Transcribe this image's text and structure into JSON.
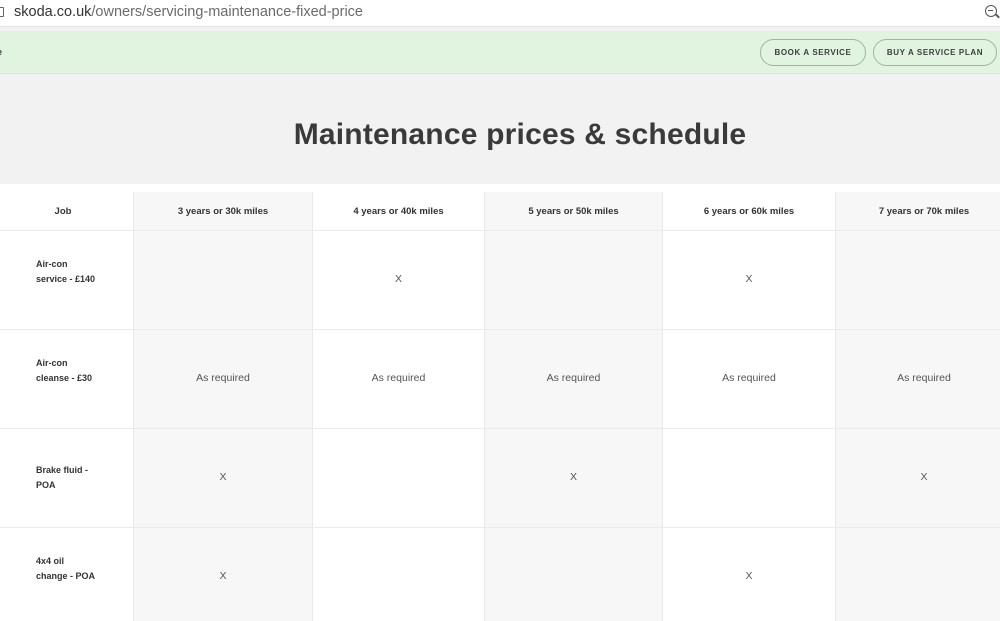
{
  "browser": {
    "url_host": "skoda.co.uk",
    "url_path": "/owners/servicing-maintenance-fixed-price"
  },
  "band": {
    "left_fragment": "e",
    "book_label": "BOOK A SERVICE",
    "plan_label": "BUY A SERVICE PLAN"
  },
  "page": {
    "title": "Maintenance prices & schedule"
  },
  "table": {
    "headers": [
      "Job",
      "3 years or 30k miles",
      "4 years or 40k miles",
      "5 years or 50k miles",
      "6 years or 60k miles",
      "7 years or 70k miles"
    ],
    "rows": [
      {
        "job": "Air-con service - £140",
        "cells": [
          "",
          "X",
          "",
          "X",
          ""
        ]
      },
      {
        "job": "Air-con cleanse - £30",
        "cells": [
          "As required",
          "As required",
          "As required",
          "As required",
          "As required"
        ]
      },
      {
        "job": "Brake fluid - POA",
        "cells": [
          "X",
          "",
          "X",
          "",
          "X"
        ]
      },
      {
        "job": "4x4 oil change - POA",
        "cells": [
          "X",
          "",
          "",
          "X",
          ""
        ]
      }
    ]
  }
}
